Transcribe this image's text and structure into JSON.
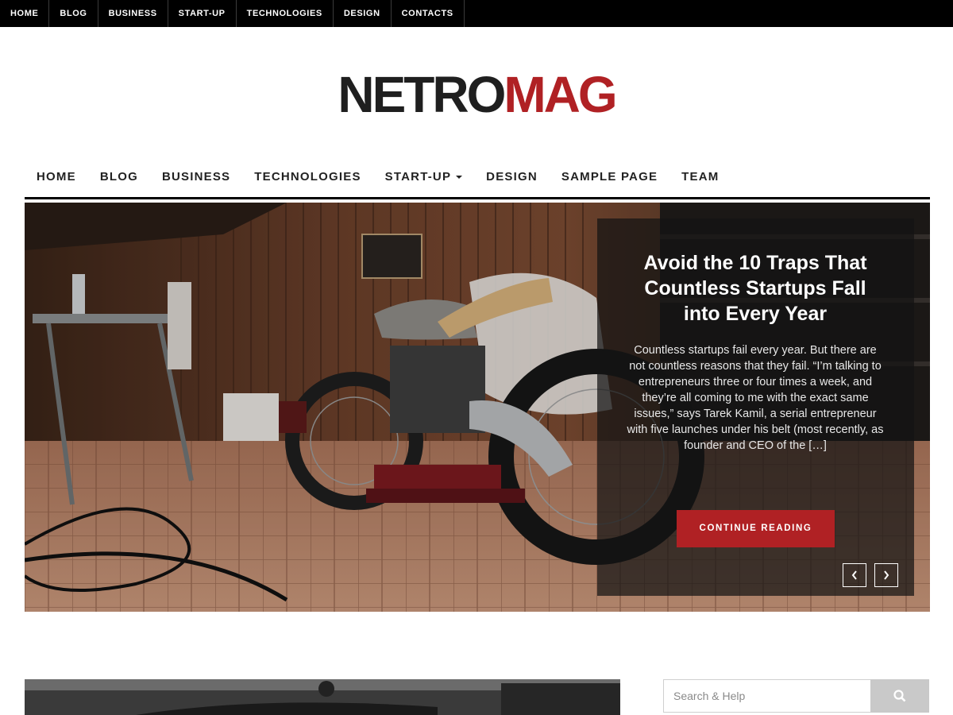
{
  "topbar": {
    "items": [
      "HOME",
      "BLOG",
      "BUSINESS",
      "START-UP",
      "TECHNOLOGIES",
      "DESIGN",
      "CONTACTS"
    ]
  },
  "logo": {
    "part1": "NETRO",
    "part2": "MAG"
  },
  "mainnav": {
    "items": [
      "HOME",
      "BLOG",
      "BUSINESS",
      "TECHNOLOGIES",
      "START-UP",
      "DESIGN",
      "SAMPLE PAGE",
      "TEAM"
    ]
  },
  "hero": {
    "title": "Avoid the 10 Traps That Countless Startups Fall into Every Year",
    "excerpt": "Countless startups fail every year. But there are not countless reasons that they fail. “I’m talking to entrepreneurs three or four times a week, and they’re all coming to me with the exact same issues,” says Tarek Kamil, a serial entrepreneur with five launches under his belt (most recently, as founder and CEO of the […]",
    "cta": "CONTINUE READING",
    "prev_icon": "chevron-left-icon",
    "next_icon": "chevron-right-icon"
  },
  "search": {
    "placeholder": "Search & Help",
    "icon": "search-icon"
  },
  "colors": {
    "accent": "#b02124",
    "dark": "#000000"
  }
}
